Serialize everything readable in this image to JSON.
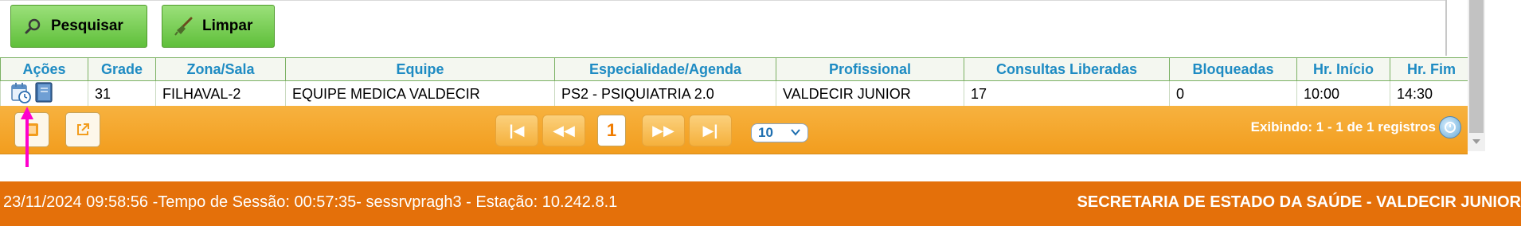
{
  "toolbar": {
    "search_label": "Pesquisar",
    "clear_label": "Limpar"
  },
  "table": {
    "headers": [
      "Ações",
      "Grade",
      "Zona/Sala",
      "Equipe",
      "Especialidade/Agenda",
      "Profissional",
      "Consultas Liberadas",
      "Bloqueadas",
      "Hr. Início",
      "Hr. Fim"
    ],
    "rows": [
      {
        "grade": "31",
        "zona_sala": "FILHAVAL-2",
        "equipe": "EQUIPE MEDICA VALDECIR",
        "especialidade": "PS2 - PSIQUIATRIA 2.0",
        "profissional": "VALDECIR JUNIOR",
        "consultas_liberadas": "17",
        "bloqueadas": "0",
        "hr_inicio": "10:00",
        "hr_fim": "14:30"
      }
    ]
  },
  "pager": {
    "current_page": "1",
    "page_size": "10",
    "info": "Exibindo: 1 - 1 de 1 registros"
  },
  "status_bar": {
    "session_info": "23/11/2024 09:58:56 -Tempo de Sessão: 00:57:35- sessrvpragh3 - Estação: 10.242.8.1",
    "org_user": "SECRETARIA DE ESTADO DA SAÚDE - VALDECIR JUNIOR"
  },
  "colors": {
    "header_text": "#1e8bc3",
    "pager_bg": "#f29d1e",
    "status_bg": "#e4700a",
    "button_green": "#5fbf3a",
    "annotation_arrow": "#ff00cc"
  },
  "icons": [
    "search-icon",
    "broom-icon",
    "calendar-clock-icon",
    "book-icon",
    "export-icon",
    "first-page-icon",
    "prev-page-icon",
    "next-page-icon",
    "last-page-icon",
    "chevron-down-icon",
    "refresh-icon"
  ]
}
